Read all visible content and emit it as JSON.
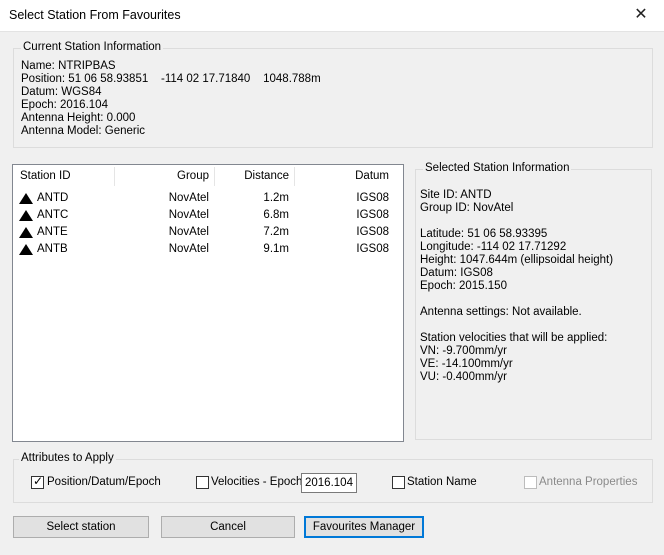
{
  "window": {
    "title": "Select Station From Favourites"
  },
  "current_station": {
    "title": "Current Station Information",
    "lines": [
      "Name: NTRIPBAS",
      "Position: 51 06 58.93851    -114 02 17.71840    1048.788m",
      "Datum: WGS84",
      "Epoch: 2016.104",
      "Antenna Height: 0.000",
      "Antenna Model: Generic"
    ]
  },
  "station_list": {
    "columns": [
      "Station ID",
      "Group",
      "Distance",
      "Datum"
    ],
    "rows": [
      {
        "id": "ANTD",
        "group": "NovAtel",
        "distance": "1.2m",
        "datum": "IGS08"
      },
      {
        "id": "ANTC",
        "group": "NovAtel",
        "distance": "6.8m",
        "datum": "IGS08"
      },
      {
        "id": "ANTE",
        "group": "NovAtel",
        "distance": "7.2m",
        "datum": "IGS08"
      },
      {
        "id": "ANTB",
        "group": "NovAtel",
        "distance": "9.1m",
        "datum": "IGS08"
      }
    ]
  },
  "selected_station": {
    "title": "Selected Station Information",
    "site_id": "Site ID: ANTD",
    "group_id": "Group ID: NovAtel",
    "latitude": "Latitude: 51 06 58.93395",
    "longitude": "Longitude: -114 02 17.71292",
    "height": "Height: 1047.644m (ellipsoidal height)",
    "datum": "Datum: IGS08",
    "epoch": "Epoch: 2015.150",
    "antenna_settings": "Antenna settings: Not available.",
    "velocities_header": "Station velocities that will be applied:",
    "vn": "VN: -9.700mm/yr",
    "ve": "VE: -14.100mm/yr",
    "vu": "VU: -0.400mm/yr"
  },
  "attributes": {
    "title": "Attributes to Apply",
    "position_label": "Position/Datum/Epoch",
    "position_checked": true,
    "velocities_label": "Velocities - Epoch:",
    "velocities_checked": false,
    "epoch_value": "2016.104",
    "station_name_label": "Station Name",
    "station_name_checked": false,
    "antenna_label": "Antenna Properties",
    "antenna_checked": false,
    "antenna_enabled": false
  },
  "buttons": {
    "select": "Select station",
    "cancel": "Cancel",
    "manager": "Favourites Manager"
  },
  "icons": {
    "close": "close-icon",
    "station": "triangle-station-icon",
    "check": "checkmark-icon"
  }
}
